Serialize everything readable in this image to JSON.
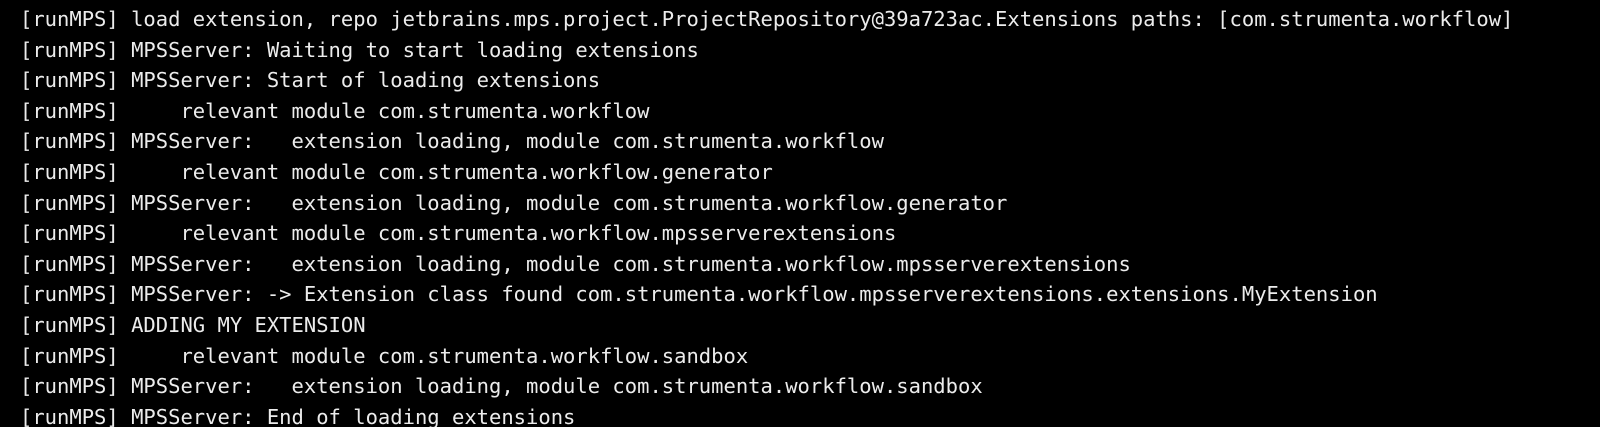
{
  "terminal": {
    "lines": [
      "[runMPS] load extension, repo jetbrains.mps.project.ProjectRepository@39a723ac.Extensions paths: [com.strumenta.workflow]",
      "[runMPS] MPSServer: Waiting to start loading extensions",
      "[runMPS] MPSServer: Start of loading extensions",
      "[runMPS]     relevant module com.strumenta.workflow",
      "[runMPS] MPSServer:   extension loading, module com.strumenta.workflow",
      "[runMPS]     relevant module com.strumenta.workflow.generator",
      "[runMPS] MPSServer:   extension loading, module com.strumenta.workflow.generator",
      "[runMPS]     relevant module com.strumenta.workflow.mpsserverextensions",
      "[runMPS] MPSServer:   extension loading, module com.strumenta.workflow.mpsserverextensions",
      "[runMPS] MPSServer: -> Extension class found com.strumenta.workflow.mpsserverextensions.extensions.MyExtension",
      "[runMPS] ADDING MY EXTENSION",
      "[runMPS]     relevant module com.strumenta.workflow.sandbox",
      "[runMPS] MPSServer:   extension loading, module com.strumenta.workflow.sandbox",
      "[runMPS] MPSServer: End of loading extensions"
    ]
  },
  "colors": {
    "background": "#000000",
    "text": "#ececec"
  }
}
